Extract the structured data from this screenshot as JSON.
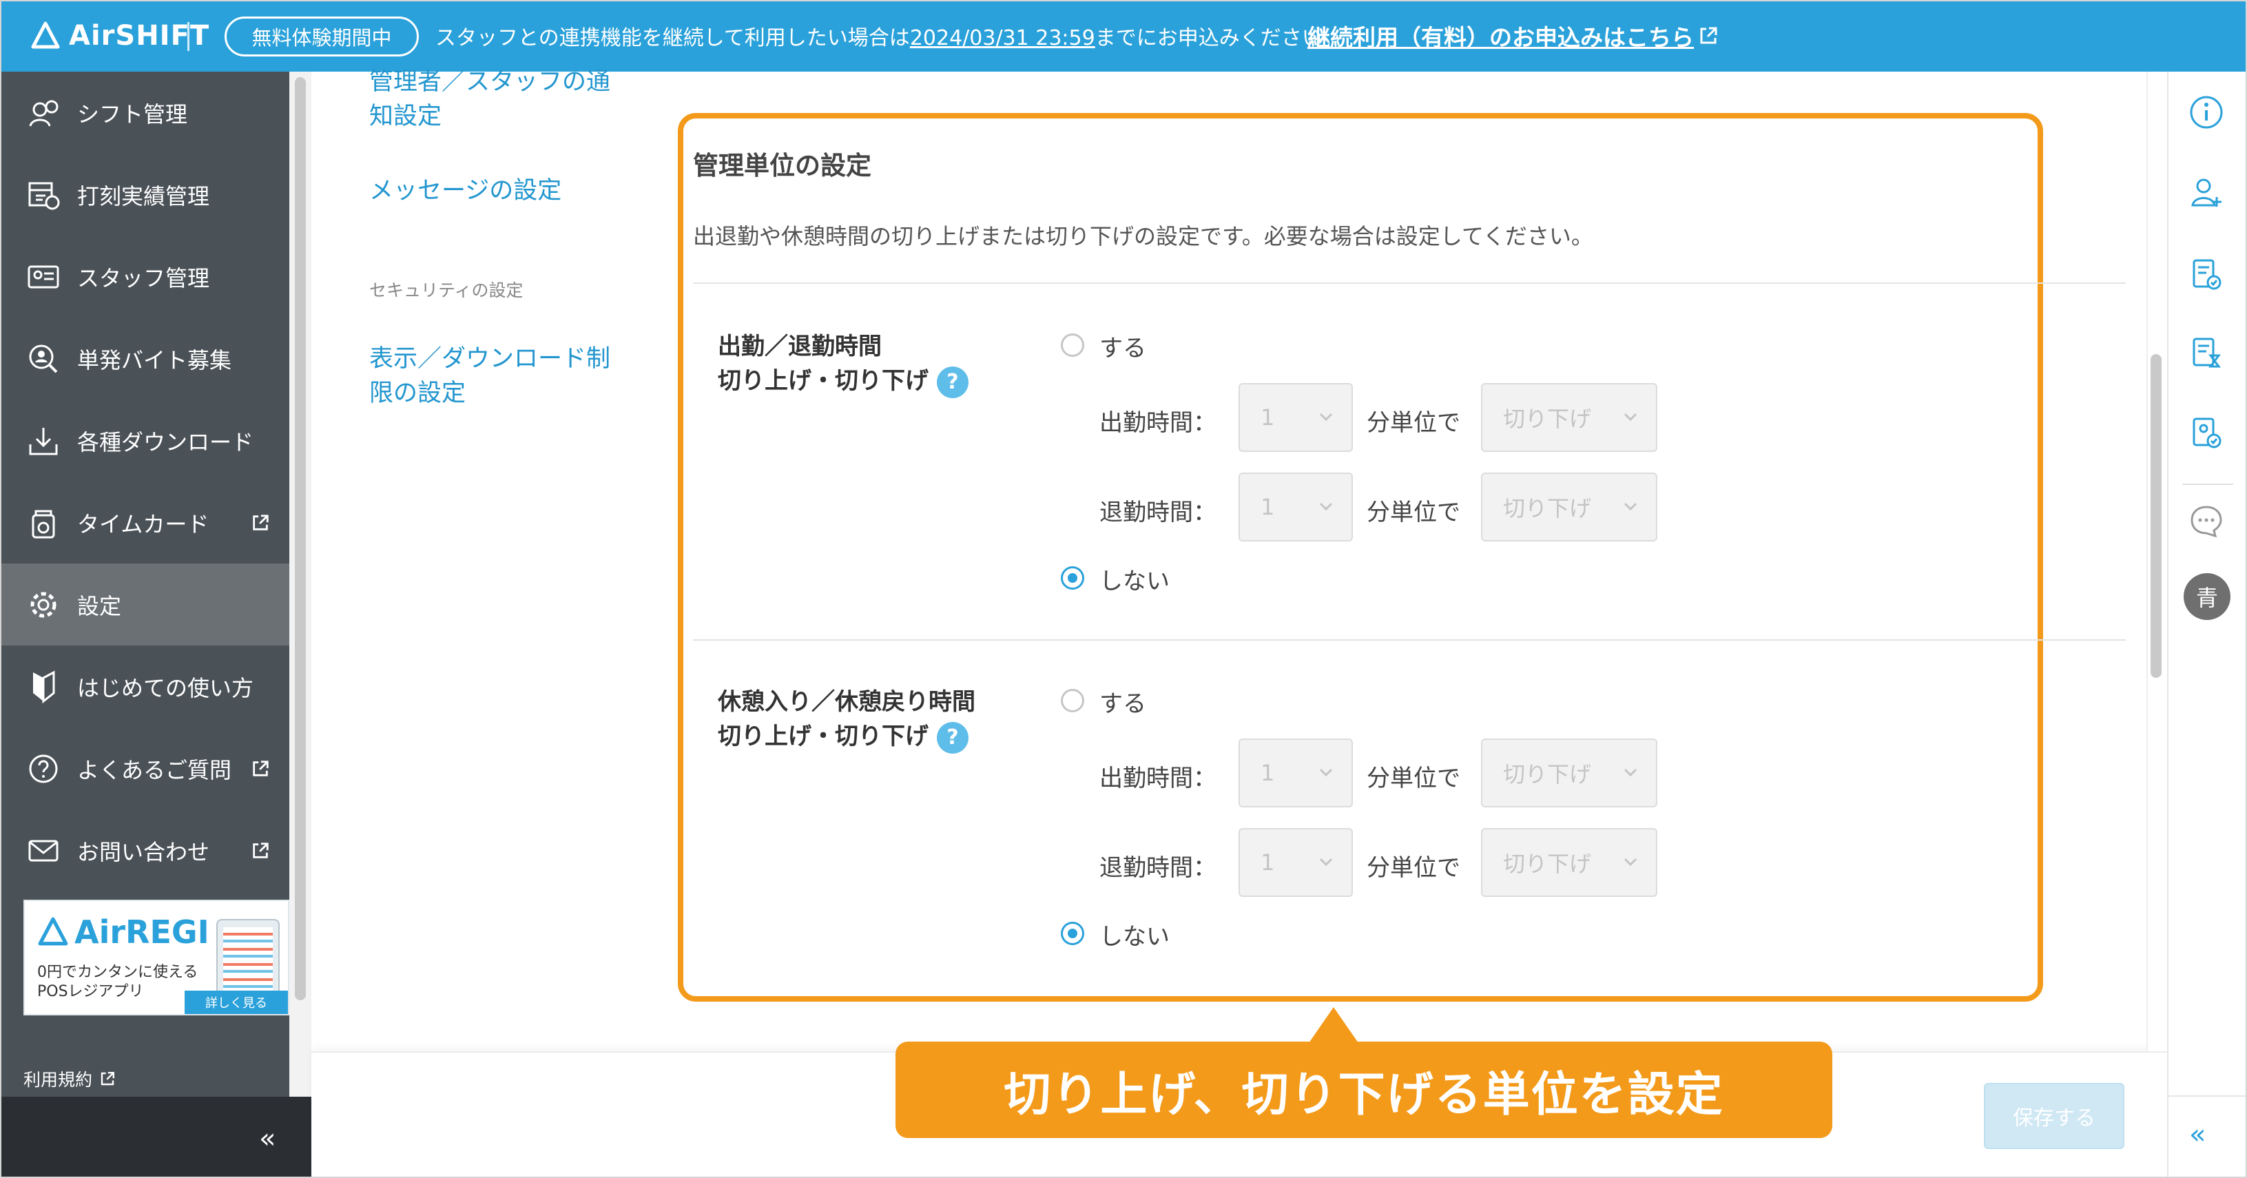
{
  "banner": {
    "logo": "AirSHIFT",
    "trial_badge": "無料体験期間中",
    "message_before": "スタッフとの連携機能を継続して利用したい場合は",
    "deadline": "2024/03/31 23:59",
    "message_after": "までにお申込みください。",
    "link": "継続利用（有料）のお申込みはこちら"
  },
  "sidebar": {
    "items": [
      {
        "label": "シフト管理",
        "icon": "shift-icon"
      },
      {
        "label": "打刻実績管理",
        "icon": "timestamp-icon"
      },
      {
        "label": "スタッフ管理",
        "icon": "staff-icon"
      },
      {
        "label": "単発バイト募集",
        "icon": "recruit-icon"
      },
      {
        "label": "各種ダウンロード",
        "icon": "download-icon"
      },
      {
        "label": "タイムカード",
        "icon": "timecard-icon"
      },
      {
        "label": "設定",
        "icon": "gear-icon"
      },
      {
        "label": "はじめての使い方",
        "icon": "beginner-icon"
      },
      {
        "label": "よくあるご質問",
        "icon": "question-icon"
      },
      {
        "label": "お問い合わせ",
        "icon": "mail-icon"
      }
    ],
    "ad": {
      "logo": "AirREGI",
      "line1": "0円でカンタンに使える",
      "line2": "POSレジアプリ",
      "button": "詳しく見る"
    },
    "terms": "利用規約"
  },
  "submenu": {
    "notification": "管理者／スタッフの通",
    "notification2": "知設定",
    "message": "メッセージの設定",
    "security_caption": "セキュリティの設定",
    "display1": "表示／ダウンロード制",
    "display2": "限の設定"
  },
  "card": {
    "title": "管理単位の設定",
    "description": "出退勤や休憩時間の切り上げまたは切り下げの設定です。必要な場合は設定してください。",
    "sections": [
      {
        "title1": "出勤／退勤時間",
        "title2": "切り上げ・切り下げ",
        "help": "?",
        "on_label": "する",
        "off_label": "しない",
        "rows": [
          {
            "label": "出勤時間：",
            "minutes": "1",
            "unit": "分単位で",
            "mode": "切り下げ"
          },
          {
            "label": "退勤時間：",
            "minutes": "1",
            "unit": "分単位で",
            "mode": "切り下げ"
          }
        ],
        "selected": "しない"
      },
      {
        "title1": "休憩入り／休憩戻り時間",
        "title2": "切り上げ・切り下げ",
        "help": "?",
        "on_label": "する",
        "off_label": "しない",
        "rows": [
          {
            "label": "出勤時間：",
            "minutes": "1",
            "unit": "分単位で",
            "mode": "切り下げ"
          },
          {
            "label": "退勤時間：",
            "minutes": "1",
            "unit": "分単位で",
            "mode": "切り下げ"
          }
        ],
        "selected": "しない"
      }
    ]
  },
  "callout": "切り上げ、切り下げる単位を設定",
  "footer": {
    "save": "保存する"
  },
  "right_panel": {
    "icons": [
      "info-icon",
      "add-user-icon",
      "checklist-icon",
      "pending-icon",
      "approval-icon",
      "chat-icon"
    ],
    "avatar": "青"
  },
  "colors": {
    "brand": "#2aa1da",
    "sidebar": "#4a5157",
    "highlight": "#f39a1a",
    "link": "#2396cf"
  }
}
